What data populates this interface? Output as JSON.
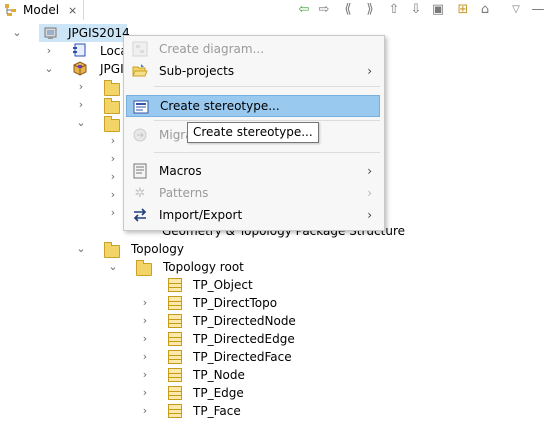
{
  "view": {
    "tab_title": "Model",
    "tab_close": "⨯",
    "toolbar": {
      "back_icon": "⇦",
      "forward_icon": "⇨",
      "collapse_icon": "⟪",
      "expand_icon": "⟫",
      "up_icon": "⇧",
      "down_icon": "⇩",
      "collapse_all_icon": "▣",
      "link_icon": "⊞",
      "home_icon": "⌂",
      "menu_icon": "▽",
      "minimize_icon": "—"
    }
  },
  "tree": {
    "root_label": "JPGIS2014",
    "local_label": "Loca",
    "jpgis_label": "JPGI",
    "geometry_label": "Geometry & Topology Package Structure",
    "topology_label": "Topology",
    "topology_root_label": "Topology root",
    "classes": [
      "TP_Object",
      "TP_DirectTopo",
      "TP_DirectedNode",
      "TP_DirectedEdge",
      "TP_DirectedFace",
      "TP_Node",
      "TP_Edge",
      "TP_Face"
    ]
  },
  "context_menu": {
    "items": [
      {
        "label": "Create diagram...",
        "disabled": true,
        "submenu": false
      },
      {
        "label": "Sub-projects",
        "disabled": false,
        "submenu": true
      },
      {
        "label": "Create stereotype...",
        "disabled": false,
        "submenu": false,
        "selected": true
      },
      {
        "label": "Migra",
        "disabled": true,
        "submenu": false
      },
      {
        "label": "Macros",
        "disabled": false,
        "submenu": true
      },
      {
        "label": "Patterns",
        "disabled": true,
        "submenu": true
      },
      {
        "label": "Import/Export",
        "disabled": false,
        "submenu": true
      }
    ],
    "arrow": "›"
  },
  "tooltip": {
    "text": "Create stereotype..."
  }
}
